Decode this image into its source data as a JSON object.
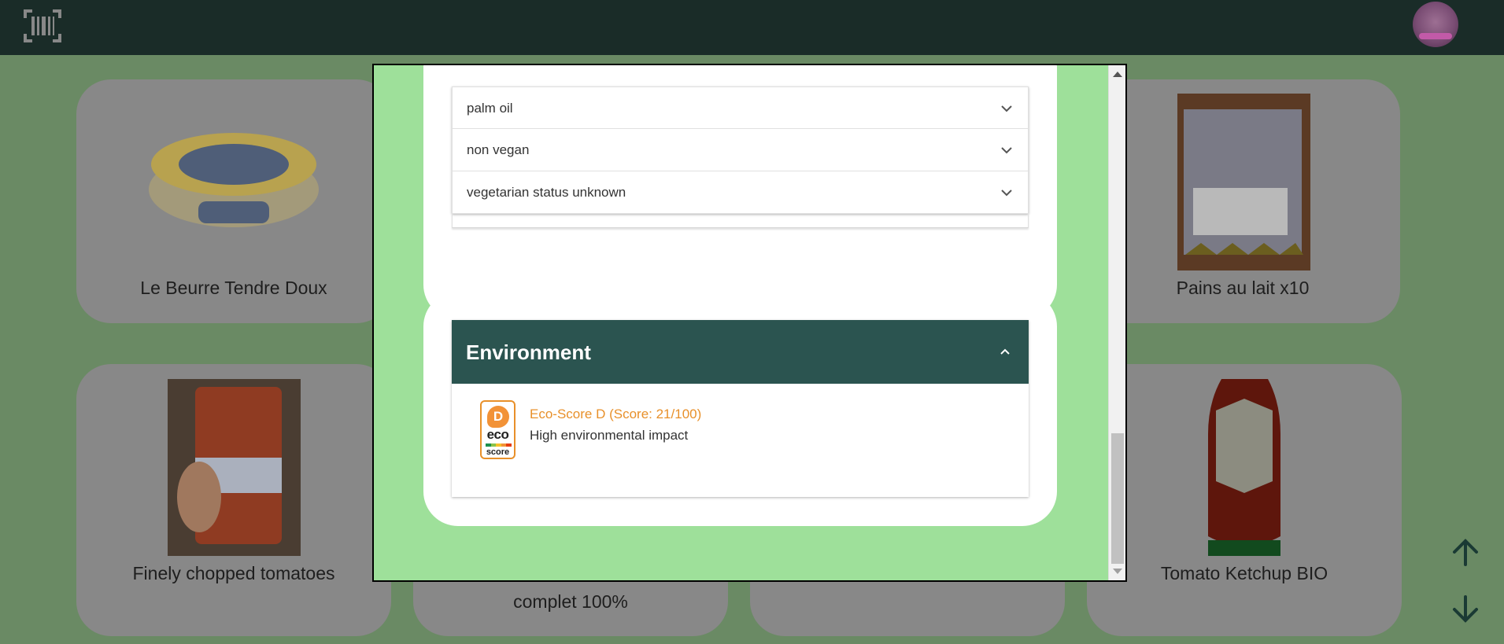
{
  "header": {
    "logo_icon": "barcode-icon",
    "avatar_icon": "user-avatar"
  },
  "products": [
    {
      "title": "Le Beurre Tendre Doux"
    },
    {
      "title": "Pains au lait x10"
    },
    {
      "title": "Finely chopped tomatoes"
    },
    {
      "title": "complet 100%"
    },
    {
      "title": "Tomato Ketchup BIO"
    }
  ],
  "nav": {
    "up_icon": "arrow-up-icon",
    "down_icon": "arrow-down-icon"
  },
  "modal": {
    "ingredients_analysis": {
      "items": [
        {
          "label": "palm oil"
        },
        {
          "label": "non vegan"
        },
        {
          "label": "vegetarian status unknown"
        }
      ]
    },
    "environment": {
      "title": "Environment",
      "eco_score": {
        "grade": "D",
        "label": "Eco-Score D (Score: 21/100)",
        "description": "High environmental impact",
        "badge_word": "eco",
        "badge_subword": "score"
      }
    }
  },
  "colors": {
    "topbar": "#1a2c28",
    "modal_bg": "#9ee09a",
    "env_header": "#2b5450",
    "eco_orange": "#e8902a"
  }
}
